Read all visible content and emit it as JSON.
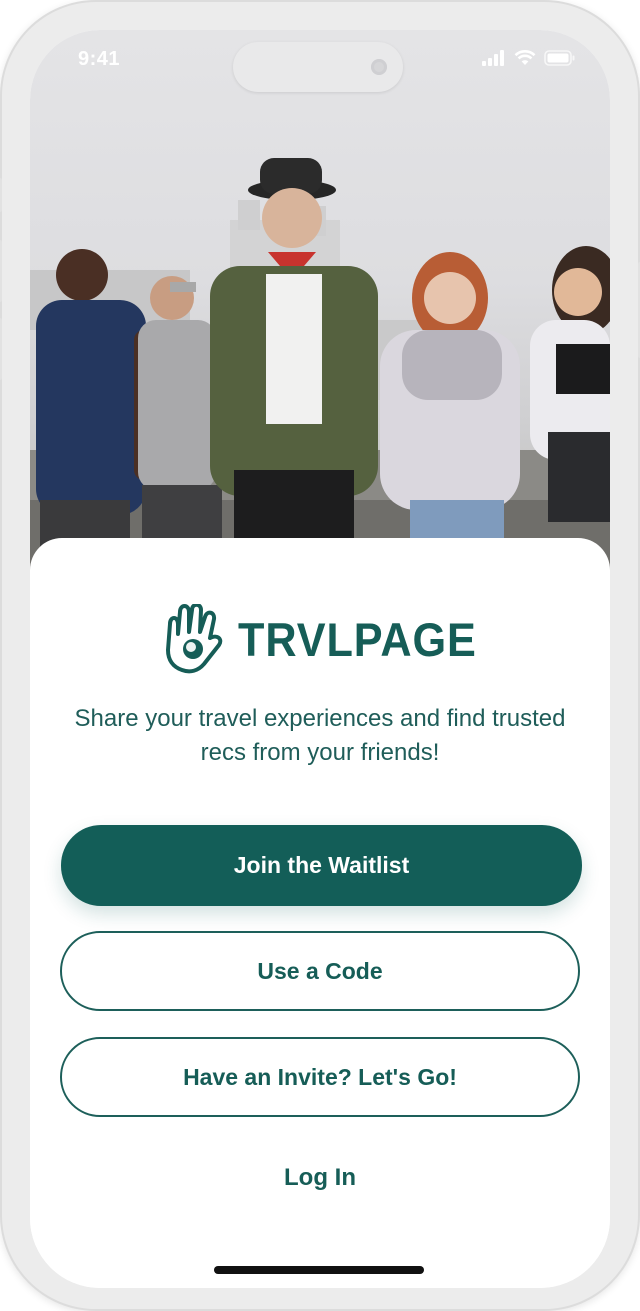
{
  "status_bar": {
    "time": "9:41"
  },
  "hero": {
    "image_alt": "Group of five friends walking together on a rooftop"
  },
  "brand": {
    "name": "TRVLPAGE",
    "color": "#165d57"
  },
  "tagline": "Share your travel experiences and find trusted recs from your friends!",
  "buttons": {
    "join": "Join the Waitlist",
    "code": "Use a Code",
    "invite": "Have an Invite? Let's Go!",
    "login": "Log In"
  },
  "colors": {
    "primary": "#135e58",
    "text": "#1f5d59",
    "background": "#ffffff"
  },
  "icons": {
    "logo": "hand-icon",
    "signal": "cellular-signal-icon",
    "wifi": "wifi-icon",
    "battery": "battery-icon"
  }
}
